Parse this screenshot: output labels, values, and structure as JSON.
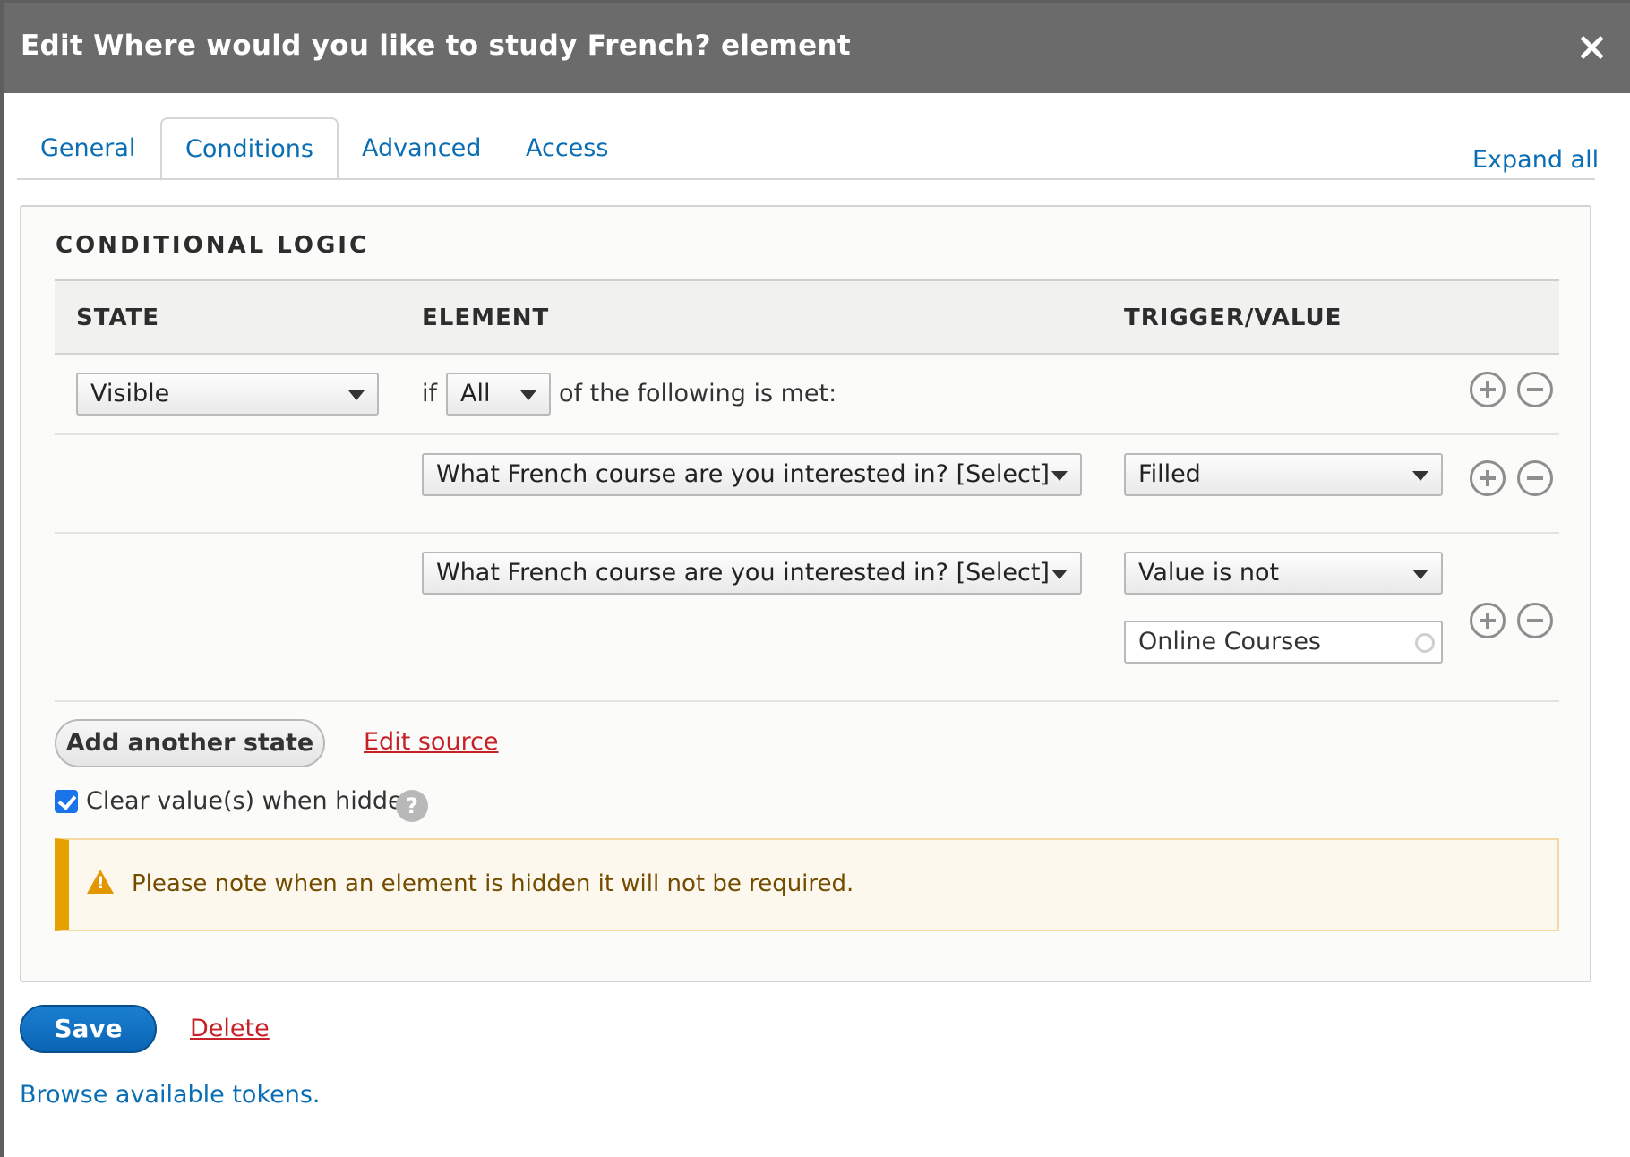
{
  "dialog": {
    "title": "Edit Where would you like to study French? element",
    "close_icon": "close-icon"
  },
  "tabs": [
    {
      "label": "General",
      "active": false
    },
    {
      "label": "Conditions",
      "active": true
    },
    {
      "label": "Advanced",
      "active": false
    },
    {
      "label": "Access",
      "active": false
    }
  ],
  "expand_all": "Expand all",
  "conditional_logic": {
    "title": "CONDITIONAL LOGIC",
    "columns": {
      "state": "STATE",
      "element": "ELEMENT",
      "trigger": "TRIGGER/VALUE"
    },
    "state_row": {
      "state": "Visible",
      "if_label": "if",
      "operator": "All",
      "suffix": "of the following is met:"
    },
    "conditions": [
      {
        "element": "What French course are you interested in? [Select]",
        "trigger": "Filled",
        "value": null
      },
      {
        "element": "What French course are you interested in? [Select]",
        "trigger": "Value is not",
        "value": "Online Courses"
      }
    ],
    "add_state_label": "Add another state",
    "edit_source_label": "Edit source",
    "clear_values_label": "Clear value(s) when hidden",
    "clear_values_checked": true,
    "help_symbol": "?",
    "warning": "Please note when an element is hidden it will not be required."
  },
  "actions": {
    "save": "Save",
    "delete": "Delete",
    "tokens": "Browse available tokens."
  },
  "colors": {
    "titlebar": "#6b6b6b",
    "link": "#0a6eb4",
    "danger_link": "#c62127",
    "primary_button": "#0a64b4",
    "warning_accent": "#e6a100"
  }
}
